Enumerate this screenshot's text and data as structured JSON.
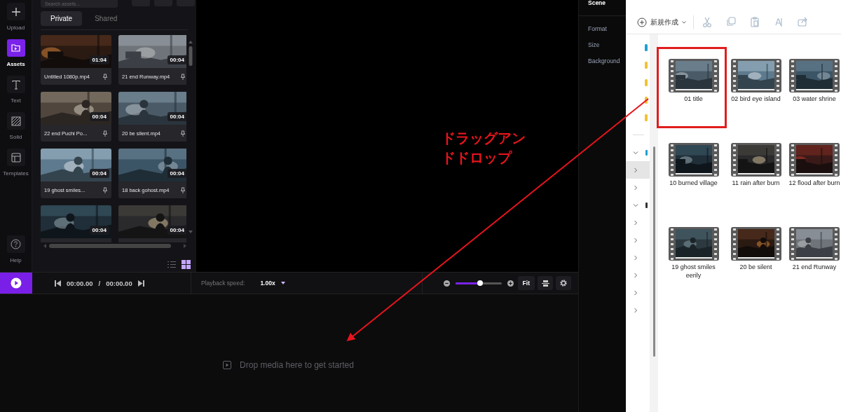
{
  "rail": {
    "items": [
      {
        "label": "Upload",
        "selected": false
      },
      {
        "label": "Assets",
        "selected": true
      },
      {
        "label": "Text",
        "selected": false
      },
      {
        "label": "Solid",
        "selected": false
      },
      {
        "label": "Templates",
        "selected": false
      }
    ],
    "help": {
      "label": "Help"
    }
  },
  "assets": {
    "search": {
      "placeholder": "Search assets..."
    },
    "tabs": [
      {
        "label": "Private",
        "selected": true
      },
      {
        "label": "Shared",
        "selected": false
      }
    ],
    "cards": [
      {
        "name": "Untitled 1080p.mp4",
        "duration": "01:04"
      },
      {
        "name": "21 end Runway.mp4",
        "duration": "00:04"
      },
      {
        "name": "22 end Puchi Po...",
        "duration": "00:04"
      },
      {
        "name": "20 be silent.mp4",
        "duration": "00:04"
      },
      {
        "name": "19 ghost smiles...",
        "duration": "00:04"
      },
      {
        "name": "18 back gohost.mp4",
        "duration": "00:04"
      },
      {
        "duration": "00:04"
      },
      {
        "duration": "00:04"
      }
    ],
    "view_modes": [
      {
        "selected": false
      },
      {
        "selected": true
      }
    ]
  },
  "annotation": {
    "text": "ドラッグアンドドロップ"
  },
  "scene_panel": {
    "title": "Scene",
    "items": [
      "Format",
      "Size",
      "Background"
    ]
  },
  "explorer": {
    "new_button": "新規作成",
    "quick_access": [
      {
        "color": "#1e9fd6"
      },
      {
        "color": "#f2c230"
      },
      {
        "color": "#f2c230"
      },
      {
        "color": "#f2c230"
      },
      {
        "color": "#f2c230"
      }
    ],
    "nav_items": [
      {
        "expanded": true,
        "selected": false,
        "color": "#1e9fd6"
      },
      {
        "expanded": false,
        "selected": true
      },
      {
        "expanded": false,
        "selected": false
      },
      {
        "expanded": true,
        "selected": false,
        "color": "#333333"
      },
      {
        "expanded": false,
        "selected": false
      },
      {
        "expanded": false,
        "selected": false
      },
      {
        "expanded": false,
        "selected": false
      },
      {
        "expanded": false,
        "selected": false
      },
      {
        "expanded": false,
        "selected": false
      },
      {
        "expanded": false,
        "selected": false
      }
    ],
    "files": [
      {
        "name": "01 title",
        "highlighted": true
      },
      {
        "name": "02 bird eye island",
        "highlighted": false
      },
      {
        "name": "03 water shrine",
        "highlighted": false
      },
      {
        "name": "10 burned village",
        "highlighted": false
      },
      {
        "name": "11 rain after burn",
        "highlighted": false
      },
      {
        "name": "12 flood after burn",
        "highlighted": false
      },
      {
        "name": "19 ghost smiles eerily",
        "highlighted": false
      },
      {
        "name": "20 be silent",
        "highlighted": false
      },
      {
        "name": "21 end Runway",
        "highlighted": false
      }
    ]
  },
  "playback": {
    "current": "00:00.00",
    "separator": "/",
    "total": "00:00.00",
    "speed_label": "Playback speed:",
    "speed": "1.00x",
    "zoom": {
      "level": 0.53
    },
    "fit": "Fit"
  },
  "timeline": {
    "empty_text": "Drop media here to get started"
  }
}
